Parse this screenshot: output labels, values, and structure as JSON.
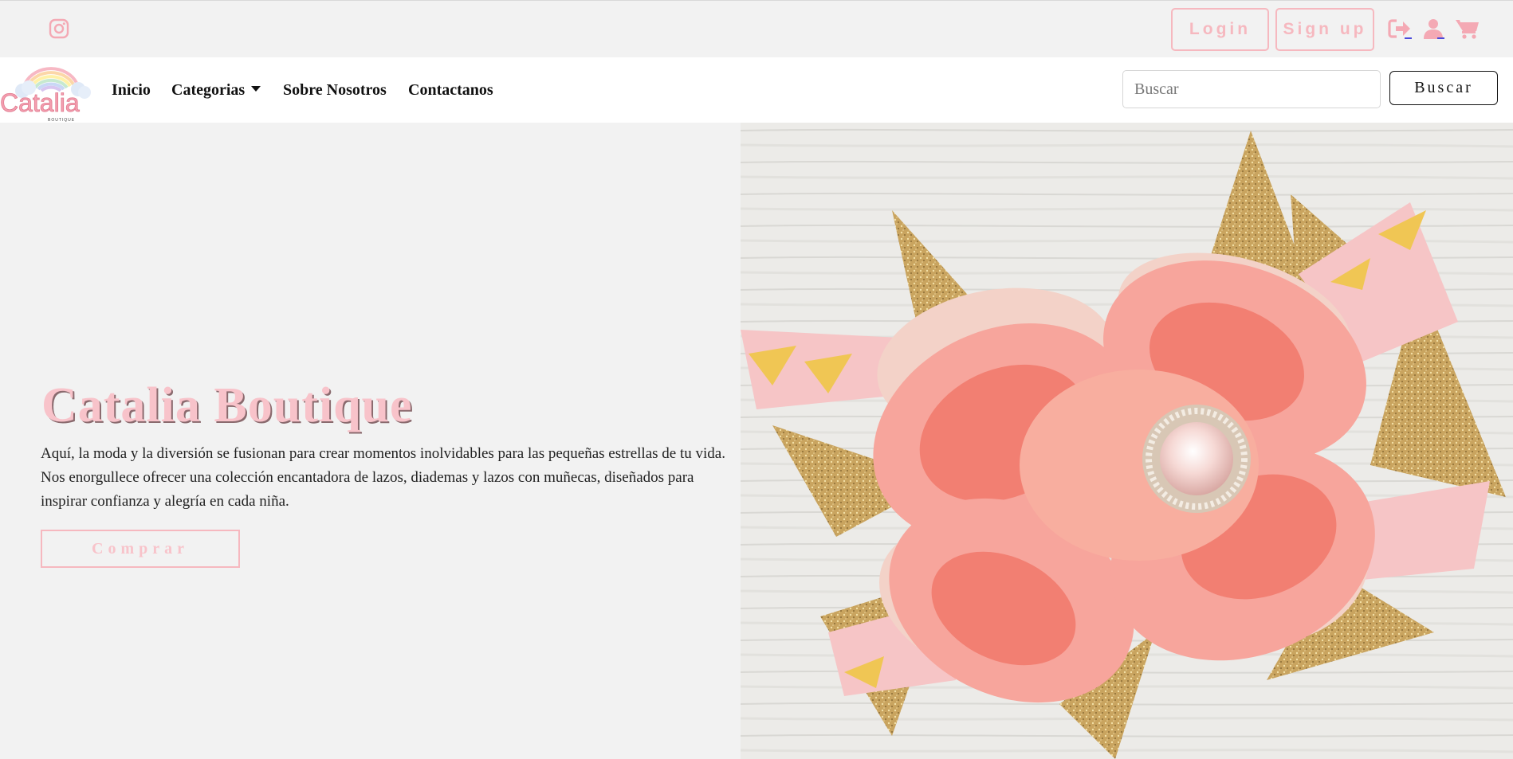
{
  "topbar": {
    "instagram_icon": "instagram-icon",
    "login_label": "Login",
    "signup_label": "Sign up",
    "icons": [
      "logout-icon",
      "user-icon",
      "cart-icon"
    ]
  },
  "navbar": {
    "logo_text": "Catalia",
    "logo_subtext": "BOUTIQUE",
    "links": [
      "Inicio",
      "Categorias",
      "Sobre Nosotros",
      "Contactanos"
    ],
    "search_placeholder": "Buscar",
    "search_button": "Buscar"
  },
  "hero": {
    "title": "Catalia Boutique",
    "text": "Aquí, la moda y la diversión se fusionan para crear momentos inolvidables para las pequeñas estrellas de tu vida. Nos enorgullece ofrecer una colección encantadora de lazos, diademas y lazos con muñecas, diseñados para inspirar confianza y alegría en cada niña.",
    "button_label": "Comprar"
  },
  "colors": {
    "accent_pink": "#f6b8bf",
    "page_bg": "#f2f2f2",
    "icon_pink": "#f4a9b4"
  }
}
